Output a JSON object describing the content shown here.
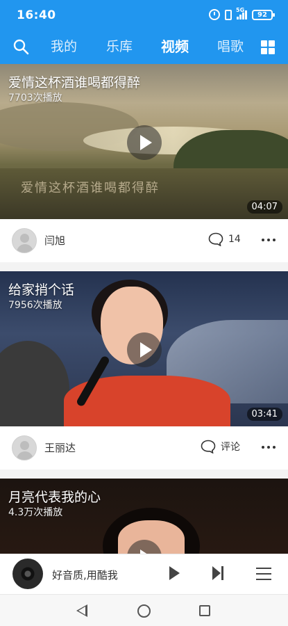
{
  "status_bar": {
    "time": "16:40",
    "network_label": "5G",
    "battery": "92"
  },
  "header": {
    "tabs": [
      {
        "label": "我的",
        "active": false
      },
      {
        "label": "乐库",
        "active": false
      },
      {
        "label": "视频",
        "active": true
      },
      {
        "label": "唱歌",
        "active": false
      }
    ],
    "accent_color": "#2196ef"
  },
  "videos": [
    {
      "title": "爱情这杯酒谁喝都得醉",
      "plays": "7703次播放",
      "duration": "04:07",
      "embedded_caption": "爱情这杯酒谁喝都得醉",
      "author": "闫旭",
      "comment_label": "14"
    },
    {
      "title": "给家捎个话",
      "plays": "7956次播放",
      "duration": "03:41",
      "author": "王丽达",
      "comment_label": "评论"
    },
    {
      "title": "月亮代表我的心",
      "plays": "4.3万次播放"
    }
  ],
  "player": {
    "title": "好音质,用酷我"
  }
}
